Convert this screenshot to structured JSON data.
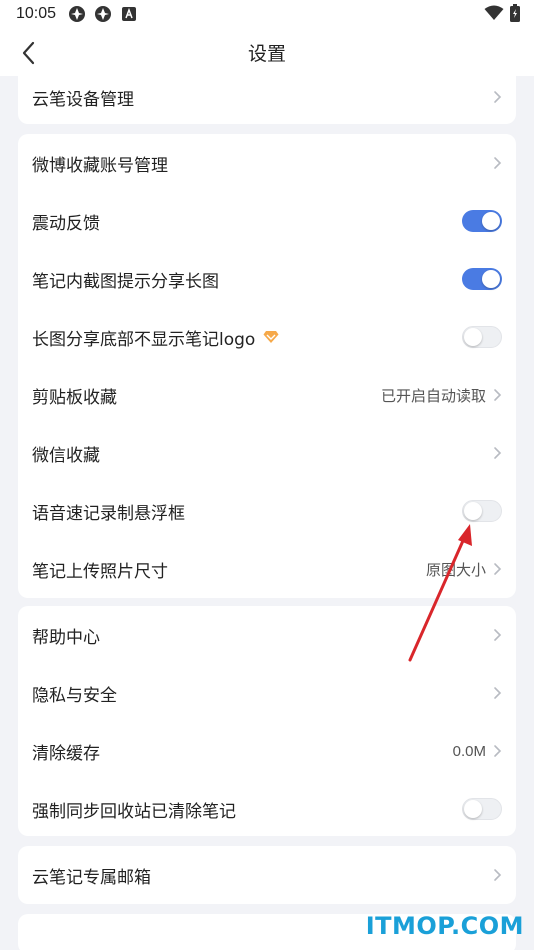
{
  "status_bar": {
    "time": "10:05"
  },
  "nav": {
    "title": "设置"
  },
  "card1": {
    "items": [
      {
        "label": "云笔设备管理"
      }
    ]
  },
  "card2": {
    "items": [
      {
        "label": "微博收藏账号管理"
      },
      {
        "label": "震动反馈",
        "toggle": "on"
      },
      {
        "label": "笔记内截图提示分享长图",
        "toggle": "on"
      },
      {
        "label": "长图分享底部不显示笔记logo",
        "toggle": "off",
        "badge": "vip-diamond-icon"
      },
      {
        "label": "剪贴板收藏",
        "value": "已开启自动读取"
      },
      {
        "label": "微信收藏"
      },
      {
        "label": "语音速记录制悬浮框",
        "toggle": "off"
      },
      {
        "label": "笔记上传照片尺寸",
        "value": "原图大小"
      }
    ]
  },
  "card3": {
    "items": [
      {
        "label": "帮助中心"
      },
      {
        "label": "隐私与安全"
      },
      {
        "label": "清除缓存",
        "value": "0.0M"
      },
      {
        "label": "强制同步回收站已清除笔记",
        "toggle": "off"
      }
    ]
  },
  "card4": {
    "items": [
      {
        "label": "云笔记专属邮箱"
      }
    ]
  },
  "watermark": "ITMOP.COM",
  "colors": {
    "accent": "#4a7be3",
    "background": "#f2f3f7",
    "annotation_arrow": "#d9262b",
    "watermark": "#1aa0d8"
  }
}
